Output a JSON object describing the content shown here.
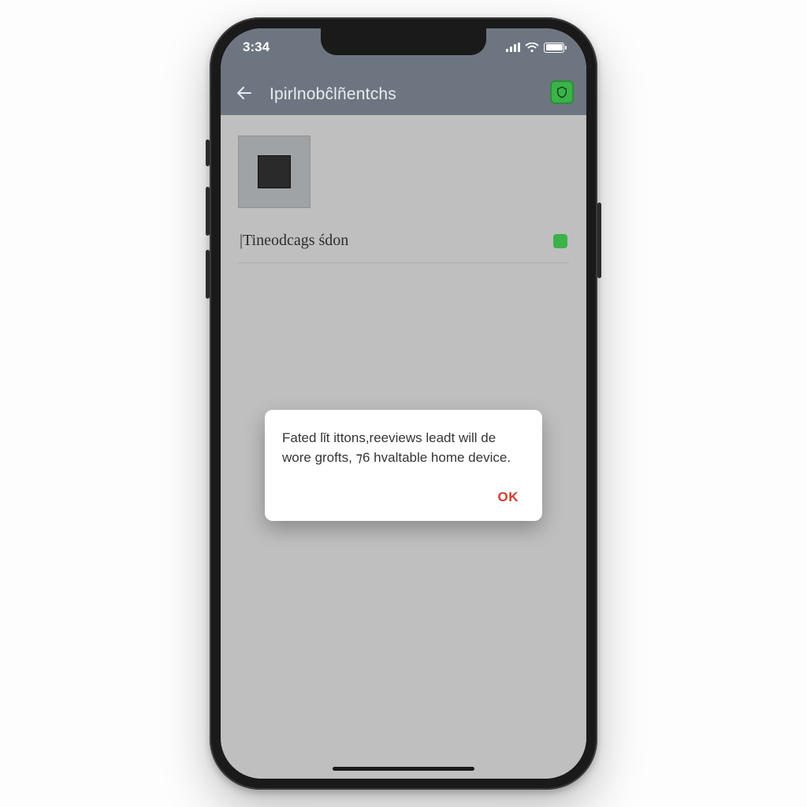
{
  "statusbar": {
    "time": "3:34"
  },
  "header": {
    "title": "Ipirlnobĉlñentchs"
  },
  "content": {
    "row_label": "|Tineodcags śdon"
  },
  "dialog": {
    "message": "Fated lǐt ittons,reeviews leadt will de wore grofts, ⁊6 hvaltable home device.",
    "ok_label": "OK"
  }
}
